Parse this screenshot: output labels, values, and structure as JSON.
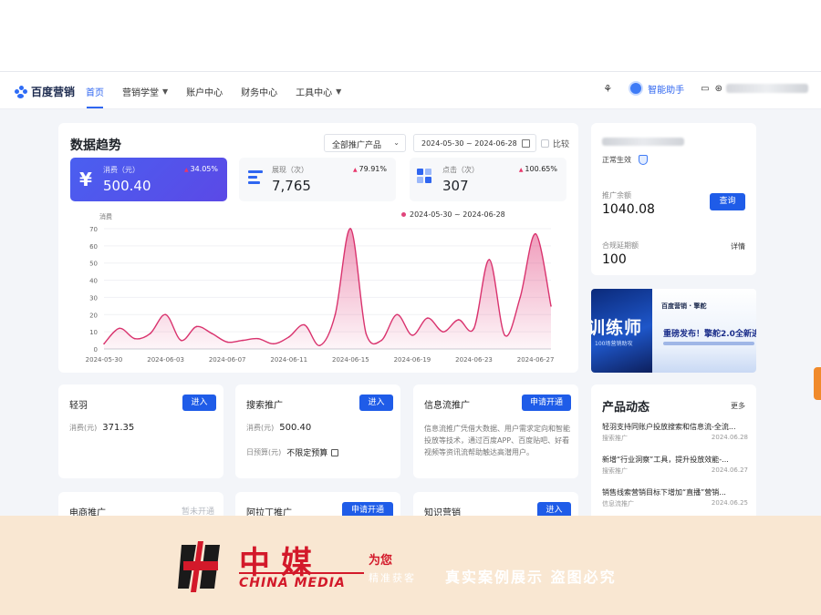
{
  "header": {
    "logo_text": "百度营销",
    "nav": [
      {
        "label": "首页",
        "active": true
      },
      {
        "label": "营销学堂",
        "dropdown": true
      },
      {
        "label": "账户中心"
      },
      {
        "label": "财务中心"
      },
      {
        "label": "工具中心",
        "dropdown": true
      }
    ],
    "assistant_label": "智能助手"
  },
  "trend": {
    "title": "数据趋势",
    "product_select": "全部推广产品",
    "date_range": "2024-05-30 ~ 2024-06-28",
    "compare_label": "比较",
    "metrics": [
      {
        "icon": "¥",
        "label": "消费（元）",
        "value": "500.40",
        "change": "34.05%"
      },
      {
        "label": "展现（次）",
        "value": "7,765",
        "change": "79.91%"
      },
      {
        "label": "点击（次）",
        "value": "307",
        "change": "100.65%"
      }
    ],
    "legend": "2024-05-30 ~ 2024-06-28"
  },
  "chart_data": {
    "type": "line",
    "ylabel": "消费",
    "ylim": [
      0,
      70
    ],
    "yticks": [
      0,
      10,
      20,
      30,
      40,
      50,
      60,
      70
    ],
    "xticks": [
      "2024-05-30",
      "2024-06-03",
      "2024-06-07",
      "2024-06-11",
      "2024-06-15",
      "2024-06-19",
      "2024-06-23",
      "2024-06-27"
    ],
    "series": [
      {
        "color": "#d9336e",
        "x": [
          "2024-05-30",
          "2024-05-31",
          "2024-06-01",
          "2024-06-02",
          "2024-06-03",
          "2024-06-04",
          "2024-06-05",
          "2024-06-06",
          "2024-06-07",
          "2024-06-08",
          "2024-06-09",
          "2024-06-10",
          "2024-06-11",
          "2024-06-12",
          "2024-06-13",
          "2024-06-14",
          "2024-06-15",
          "2024-06-16",
          "2024-06-17",
          "2024-06-18",
          "2024-06-19",
          "2024-06-20",
          "2024-06-21",
          "2024-06-22",
          "2024-06-23",
          "2024-06-24",
          "2024-06-25",
          "2024-06-26",
          "2024-06-27",
          "2024-06-28"
        ],
        "values": [
          3,
          12,
          6,
          9,
          20,
          5,
          13,
          9,
          4,
          5,
          6,
          3,
          7,
          14,
          2,
          20,
          70,
          9,
          5,
          20,
          8,
          18,
          10,
          17,
          12,
          52,
          8,
          30,
          67,
          25
        ]
      }
    ]
  },
  "account": {
    "status": "正常生效",
    "balance_label": "推广余额",
    "balance_value": "1040.08",
    "query_button": "查询",
    "secondary_label": "合规延期额",
    "secondary_value": "100",
    "detail_link": "详情"
  },
  "banner": {
    "left_text": "训练师",
    "left_sub": "100场营销助攻",
    "logo": "百度营销 · 擎舵",
    "headline": "重磅发布！擎舵2.0全新进"
  },
  "products": [
    {
      "title": "轻羽",
      "button": "进入",
      "rows": [
        {
          "label": "消费(元)",
          "value": "371.35"
        }
      ]
    },
    {
      "title": "搜索推广",
      "button": "进入",
      "rows": [
        {
          "label": "消费(元)",
          "value": "500.40"
        },
        {
          "label": "日预算(元)",
          "value": "不限定预算"
        }
      ]
    },
    {
      "title": "信息流推广",
      "button": "申请开通",
      "desc": "信息流推广凭借大数据、用户需求定向和智能投放等技术，通过百度APP、百度贴吧、好看视频等资讯流帮助触达高潜用户。"
    }
  ],
  "products_row2": [
    {
      "title": "电商推广",
      "button": "暂未开通"
    },
    {
      "title": "阿拉丁推广",
      "button": "申请开通"
    },
    {
      "title": "知识营销",
      "button": "进入"
    }
  ],
  "news": {
    "title": "产品动态",
    "more": "更多",
    "items": [
      {
        "title": "轻羽支持同账户投放搜索和信息流-全流...",
        "tag": "搜索推广",
        "date": "2024.06.28"
      },
      {
        "title": "新增“行业洞察”工具，提升投放效能-...",
        "tag": "搜索推广",
        "date": "2024.06.27"
      },
      {
        "title": "销售线索营销目标下增加“直播”营销...",
        "tag": "信息流推广",
        "date": "2024.06.25"
      }
    ]
  },
  "watermark": {
    "cn": "中媒",
    "en": "CHINA MEDIA",
    "for": "为您",
    "sub": "精准获客",
    "slogan": "真实案例展示  盗图必究"
  }
}
